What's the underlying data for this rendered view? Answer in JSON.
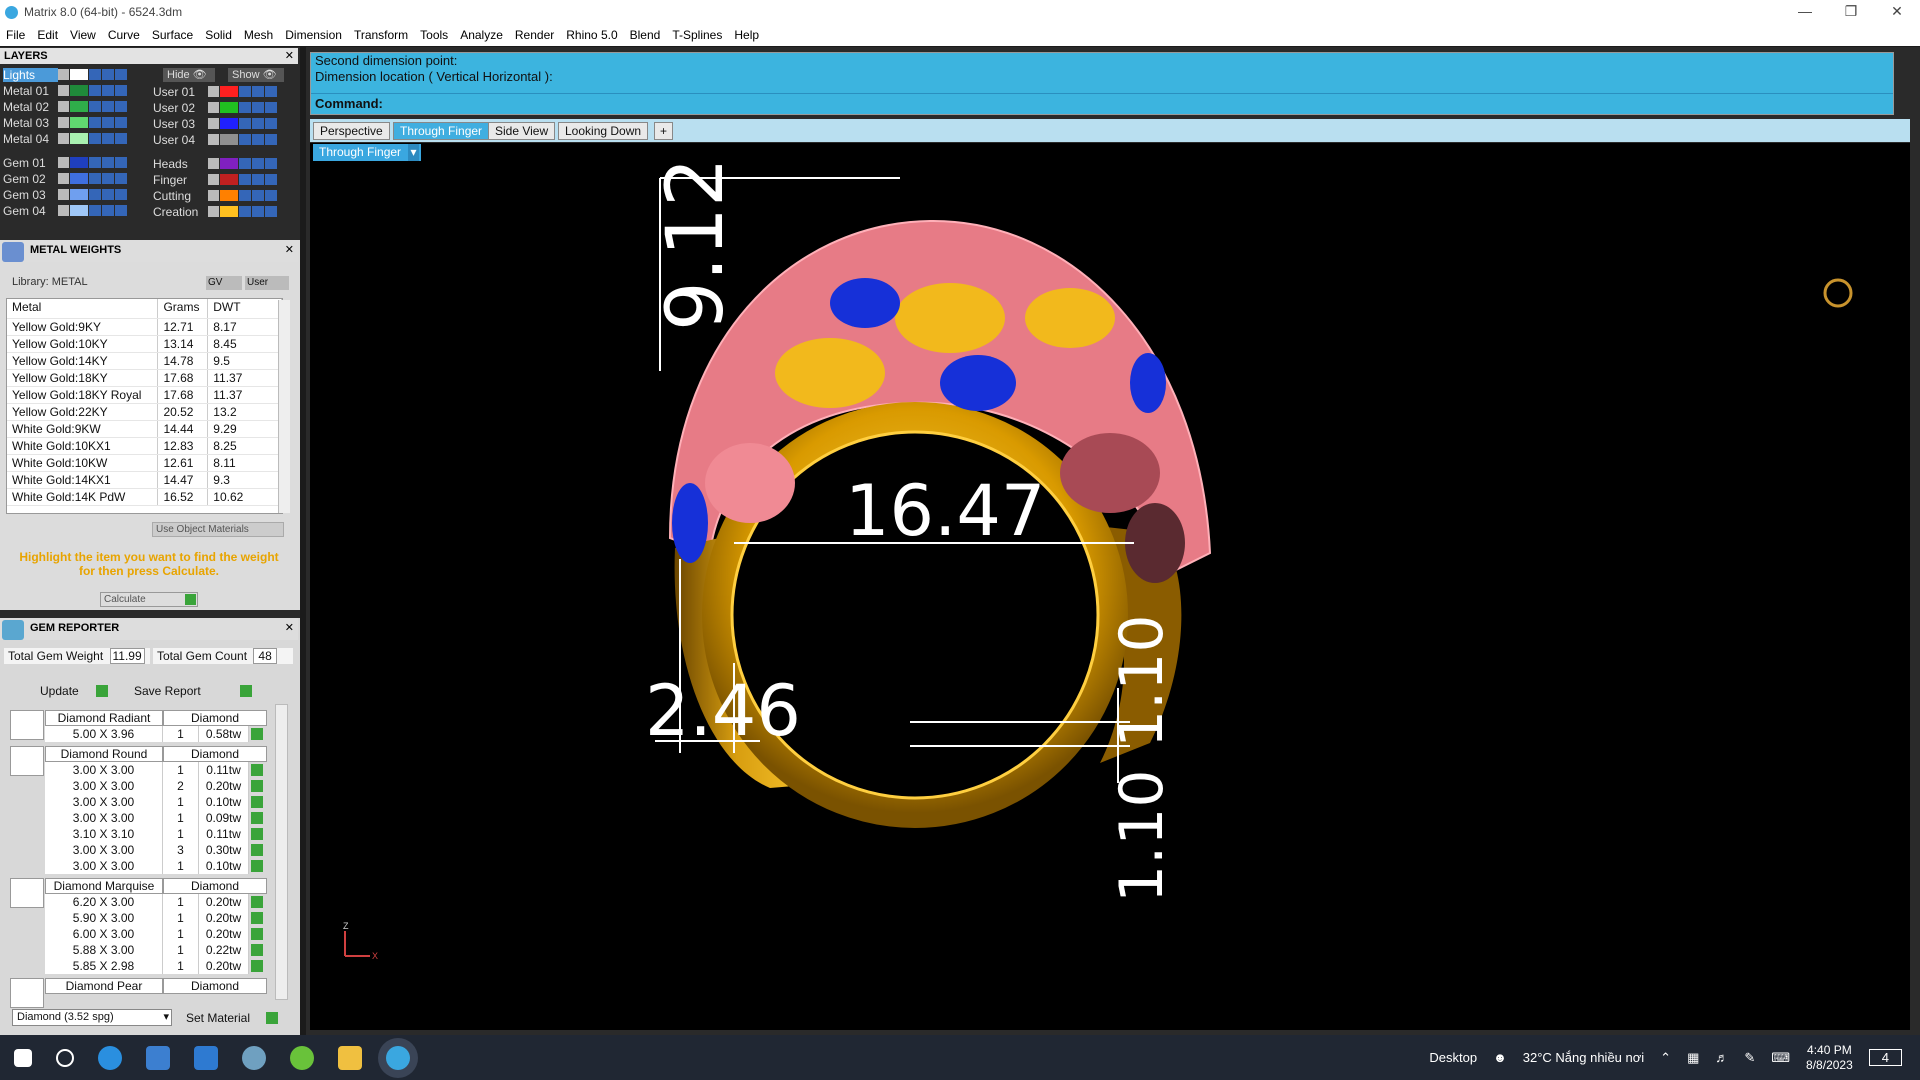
{
  "window": {
    "title": "Matrix 8.0 (64-bit) - 6524.3dm"
  },
  "menu": [
    "File",
    "Edit",
    "View",
    "Curve",
    "Surface",
    "Solid",
    "Mesh",
    "Dimension",
    "Transform",
    "Tools",
    "Analyze",
    "Render",
    "Rhino 5.0",
    "Blend",
    "T-Splines",
    "Help"
  ],
  "layers": {
    "title": "LAYERS",
    "hide": "Hide",
    "show": "Show",
    "left": [
      {
        "name": "Lights",
        "color": "#ffffff"
      },
      {
        "name": "Metal 01",
        "color": "#1f8a3a"
      },
      {
        "name": "Metal 02",
        "color": "#2fae4a"
      },
      {
        "name": "Metal 03",
        "color": "#60d870"
      },
      {
        "name": "Metal 04",
        "color": "#a8f0b0"
      },
      {
        "name": "Gem 01",
        "color": "#1f3fbf"
      },
      {
        "name": "Gem 02",
        "color": "#3f6fdf"
      },
      {
        "name": "Gem 03",
        "color": "#6f9fef"
      },
      {
        "name": "Gem 04",
        "color": "#9fc7f7"
      }
    ],
    "right": [
      {
        "name": "User 01",
        "color": "#ff2020"
      },
      {
        "name": "User 02",
        "color": "#20c020"
      },
      {
        "name": "User 03",
        "color": "#2020ff"
      },
      {
        "name": "User 04",
        "color": "#909090"
      },
      {
        "name": "Heads",
        "color": "#8020c0"
      },
      {
        "name": "Finger",
        "color": "#c02020"
      },
      {
        "name": "Cutting",
        "color": "#ff8000"
      },
      {
        "name": "Creation",
        "color": "#ffc020"
      }
    ]
  },
  "metal_weights": {
    "title": "METAL WEIGHTS",
    "library": "Library: METAL",
    "gv": "GV",
    "user": "User",
    "headers": [
      "Metal",
      "Grams",
      "DWT"
    ],
    "rows": [
      [
        "Yellow Gold:9KY",
        "12.71",
        "8.17"
      ],
      [
        "Yellow Gold:10KY",
        "13.14",
        "8.45"
      ],
      [
        "Yellow Gold:14KY",
        "14.78",
        "9.5"
      ],
      [
        "Yellow Gold:18KY",
        "17.68",
        "11.37"
      ],
      [
        "Yellow Gold:18KY Royal",
        "17.68",
        "11.37"
      ],
      [
        "Yellow Gold:22KY",
        "20.52",
        "13.2"
      ],
      [
        "White Gold:9KW",
        "14.44",
        "9.29"
      ],
      [
        "White Gold:10KX1",
        "12.83",
        "8.25"
      ],
      [
        "White Gold:10KW",
        "12.61",
        "8.11"
      ],
      [
        "White Gold:14KX1",
        "14.47",
        "9.3"
      ],
      [
        "White Gold:14K PdW",
        "16.52",
        "10.62"
      ]
    ],
    "use_object": "Use Object Materials",
    "hint": "Highlight the item you want to find the weight for then press Calculate.",
    "calculate": "Calculate"
  },
  "gem_reporter": {
    "title": "GEM REPORTER",
    "total_weight_label": "Total Gem Weight",
    "total_weight": "11.99",
    "total_count_label": "Total Gem Count",
    "total_count": "48",
    "update": "Update",
    "save_report": "Save Report",
    "groups": [
      {
        "name": "Diamond Radiant",
        "material": "Diamond",
        "rows": [
          [
            "5.00 X 3.96",
            "1",
            "0.58tw"
          ]
        ]
      },
      {
        "name": "Diamond Round",
        "material": "Diamond",
        "rows": [
          [
            "3.00 X 3.00",
            "1",
            "0.11tw"
          ],
          [
            "3.00 X 3.00",
            "2",
            "0.20tw"
          ],
          [
            "3.00 X 3.00",
            "1",
            "0.10tw"
          ],
          [
            "3.00 X 3.00",
            "1",
            "0.09tw"
          ],
          [
            "3.10 X 3.10",
            "1",
            "0.11tw"
          ],
          [
            "3.00 X 3.00",
            "3",
            "0.30tw"
          ],
          [
            "3.00 X 3.00",
            "1",
            "0.10tw"
          ]
        ]
      },
      {
        "name": "Diamond Marquise",
        "material": "Diamond",
        "rows": [
          [
            "6.20 X 3.00",
            "1",
            "0.20tw"
          ],
          [
            "5.90 X 3.00",
            "1",
            "0.20tw"
          ],
          [
            "6.00 X 3.00",
            "1",
            "0.20tw"
          ],
          [
            "5.88 X 3.00",
            "1",
            "0.22tw"
          ],
          [
            "5.85 X 2.98",
            "1",
            "0.20tw"
          ]
        ]
      },
      {
        "name": "Diamond Pear",
        "material": "Diamond",
        "rows": []
      }
    ],
    "material_select": "Diamond    (3.52 spg)",
    "set_material": "Set Material"
  },
  "command": {
    "line1": "Second dimension point:",
    "line2": "Dimension location ( Vertical  Horizontal ):",
    "label": "Command:"
  },
  "viewport_tabs": [
    "Perspective",
    "Through Finger",
    "Side View",
    "Looking Down",
    "+"
  ],
  "active_tab": "Through Finger",
  "viewport_label": "Through Finger",
  "dimensions": {
    "height": "9.12",
    "inner": "16.47",
    "shank": "2.46",
    "thick_top": "1.10",
    "thick_bottom": "1.10"
  },
  "axes": {
    "z": "Z",
    "x": "X"
  },
  "taskbar": {
    "desktop": "Desktop",
    "weather": "32°C  Nắng nhiều nơi",
    "time": "4:40 PM",
    "date": "8/8/2023",
    "notif": "4"
  }
}
